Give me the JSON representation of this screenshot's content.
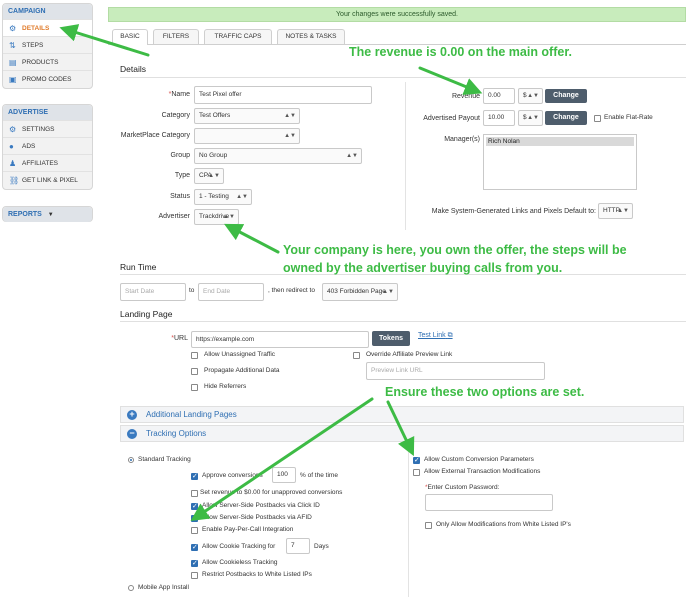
{
  "sidebar": {
    "campaign": {
      "header": "CAMPAIGN",
      "items": [
        {
          "label": "DETAILS",
          "icon": "gear-icon",
          "active": true
        },
        {
          "label": "STEPS",
          "icon": "steps-icon"
        },
        {
          "label": "PRODUCTS",
          "icon": "products-icon"
        },
        {
          "label": "PROMO CODES",
          "icon": "promo-icon"
        }
      ]
    },
    "advertise": {
      "header": "ADVERTISE",
      "items": [
        {
          "label": "SETTINGS",
          "icon": "gear-icon"
        },
        {
          "label": "ADS",
          "icon": "ads-icon"
        },
        {
          "label": "AFFILIATES",
          "icon": "users-icon"
        },
        {
          "label": "GET LINK & PIXEL",
          "icon": "link-icon"
        }
      ]
    },
    "reports": {
      "header": "REPORTS",
      "caret": "▼"
    }
  },
  "banner": {
    "message": "Your changes were successfully saved."
  },
  "tabs": [
    "BASIC",
    "FILTERS",
    "TRAFFIC CAPS",
    "NOTES & TASKS"
  ],
  "details": {
    "title": "Details",
    "name_label": "Name",
    "name_value": "Test Pixel offer",
    "category_label": "Category",
    "category_value": "Test Offers",
    "marketplace_label": "MarketPlace Category",
    "marketplace_value": "",
    "group_label": "Group",
    "group_value": "No Group",
    "type_label": "Type",
    "type_value": "CPA",
    "status_label": "Status",
    "status_value": "1 - Testing",
    "advertiser_label": "Advertiser",
    "advertiser_value": "Trackdrive",
    "revenue_label": "Revenue",
    "revenue_value": "0.00",
    "revenue_currency": "$",
    "change_label": "Change",
    "payout_label": "Advertised Payout",
    "payout_value": "10.00",
    "payout_currency": "$",
    "flat_rate_label": "Enable Flat-Rate",
    "managers_label": "Manager(s)",
    "manager_selected": "Rich Nolan",
    "links_default_label": "Make System-Generated Links and Pixels Default to:",
    "links_default_value": "HTTP"
  },
  "runtime": {
    "title": "Run Time",
    "start_placeholder": "Start Date",
    "to_label": "to",
    "end_placeholder": "End Date",
    "redirect_label": ", then redirect to",
    "redirect_value": "403 Forbidden Page"
  },
  "landing": {
    "title": "Landing Page",
    "url_label": "URL",
    "url_value": "https://example.com",
    "tokens_label": "Tokens",
    "test_link_label": "Test Link",
    "allow_unassigned": "Allow Unassigned Traffic",
    "override_preview": "Override Affiliate Preview Link",
    "propagate": "Propagate Additional Data",
    "preview_placeholder": "Preview Link URL",
    "hide_referrers": "Hide Referrers"
  },
  "accordions": {
    "additional": {
      "label": "Additional Landing Pages",
      "sign": "+"
    },
    "tracking": {
      "label": "Tracking Options",
      "sign": "−"
    }
  },
  "tracking": {
    "standard": "Standard Tracking",
    "approve_label": "Approve conversions",
    "approve_value": "100",
    "approve_suffix": "% of the time",
    "set_revenue": "Set revenue to $0.00 for unapproved conversions",
    "postback_click": "Allow Server-Side Postbacks via Click ID",
    "postback_afid": "Allow Server-Side Postbacks via AFID",
    "pay_per_call": "Enable Pay-Per-Call Integration",
    "cookie_label": "Allow Cookie Tracking for",
    "cookie_value": "7",
    "cookie_suffix": "Days",
    "cookieless": "Allow Cookieless Tracking",
    "restrict": "Restrict Postbacks to White Listed IPs",
    "mobile": "Mobile App Install",
    "custom_params": "Allow Custom Conversion Parameters",
    "external_mods": "Allow External Transaction Modifications",
    "password_label": "Enter Custom Password:",
    "whitelist_only": "Only Allow Modifications from White Listed IP's"
  },
  "annotations": {
    "revenue": "The revenue is 0.00 on the main offer.",
    "company_1": "Your company is here, you own the offer, the steps will be",
    "company_2": "owned by the advertiser buying calls from you.",
    "ensure": "Ensure these two options are set."
  },
  "colors": {
    "annotation": "#3dbb45",
    "accent": "#2f6fb3",
    "active_nav": "#e07b2a",
    "banner": "#c8ecbc"
  }
}
